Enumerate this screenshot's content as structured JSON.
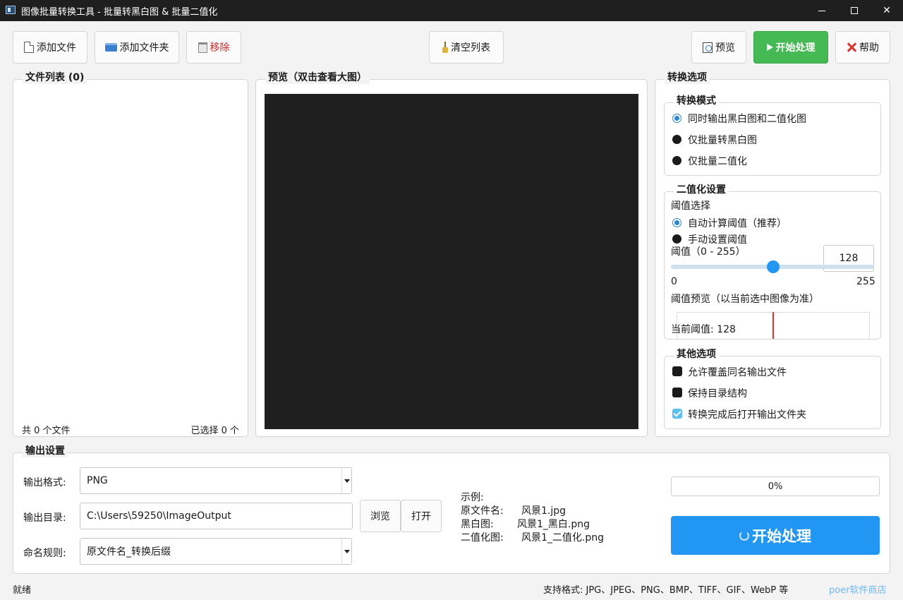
{
  "window": {
    "title": "图像批量转换工具 - 批量转黑白图 & 批量二值化"
  },
  "toolbar": {
    "add_file": "添加文件",
    "add_folder": "添加文件夹",
    "remove": "移除",
    "clear_list": "清空列表",
    "preview": "预览",
    "start": "开始处理",
    "help": "帮助"
  },
  "file_list": {
    "title": "文件列表 (0)",
    "total": "共 0 个文件",
    "selected": "已选择 0 个"
  },
  "preview_panel": {
    "title": "预览（双击查看大图）"
  },
  "options": {
    "title": "转换选项",
    "mode": {
      "title": "转换模式",
      "items": [
        "同时输出黑白图和二值化图",
        "仅批量转黑白图",
        "仅批量二值化"
      ],
      "selected_index": 0
    },
    "binarize": {
      "title": "二值化设置",
      "threshold_select_label": "阈值选择",
      "auto": "自动计算阈值（推荐）",
      "manual": "手动设置阈值",
      "auto_selected": true,
      "threshold_label": "阈值（0 - 255）",
      "threshold_value": "128",
      "slider_value": 128,
      "slider_min": "0",
      "slider_max": "255",
      "preview_label": "阈值预览（以当前选中图像为准）",
      "current_label": "当前阈值: 128"
    },
    "other": {
      "title": "其他选项",
      "overwrite": "允许覆盖同名输出文件",
      "keep_structure": "保持目录结构",
      "open_after": "转换完成后打开输出文件夹",
      "overwrite_checked": false,
      "keep_structure_checked": false,
      "open_after_checked": true
    }
  },
  "output": {
    "title": "输出设置",
    "format_label": "输出格式:",
    "format_value": "PNG",
    "dir_label": "输出目录:",
    "dir_value": "C:\\Users\\59250\\ImageOutput",
    "browse": "浏览",
    "open": "打开",
    "naming_label": "命名规则:",
    "naming_value": "原文件名_转换后缀",
    "example_title": "示例:",
    "example_original_label": "原文件名:",
    "example_original": "风景1.jpg",
    "example_bw_label": "黑白图:",
    "example_bw": "风景1_黑白.png",
    "example_bin_label": "二值化图:",
    "example_bin": "风景1_二值化.png",
    "progress_text": "0%",
    "progress_value": 0,
    "start_button": "开始处理"
  },
  "status": {
    "text": "就绪",
    "formats": "支持格式: JPG、JPEG、PNG、BMP、TIFF、GIF、WebP 等",
    "link": "poer软件商店"
  },
  "colors": {
    "accent": "#2196f3",
    "start_green": "#45b953",
    "threshold_line": "#d9342b",
    "preview_bg": "#1f1f1f"
  }
}
